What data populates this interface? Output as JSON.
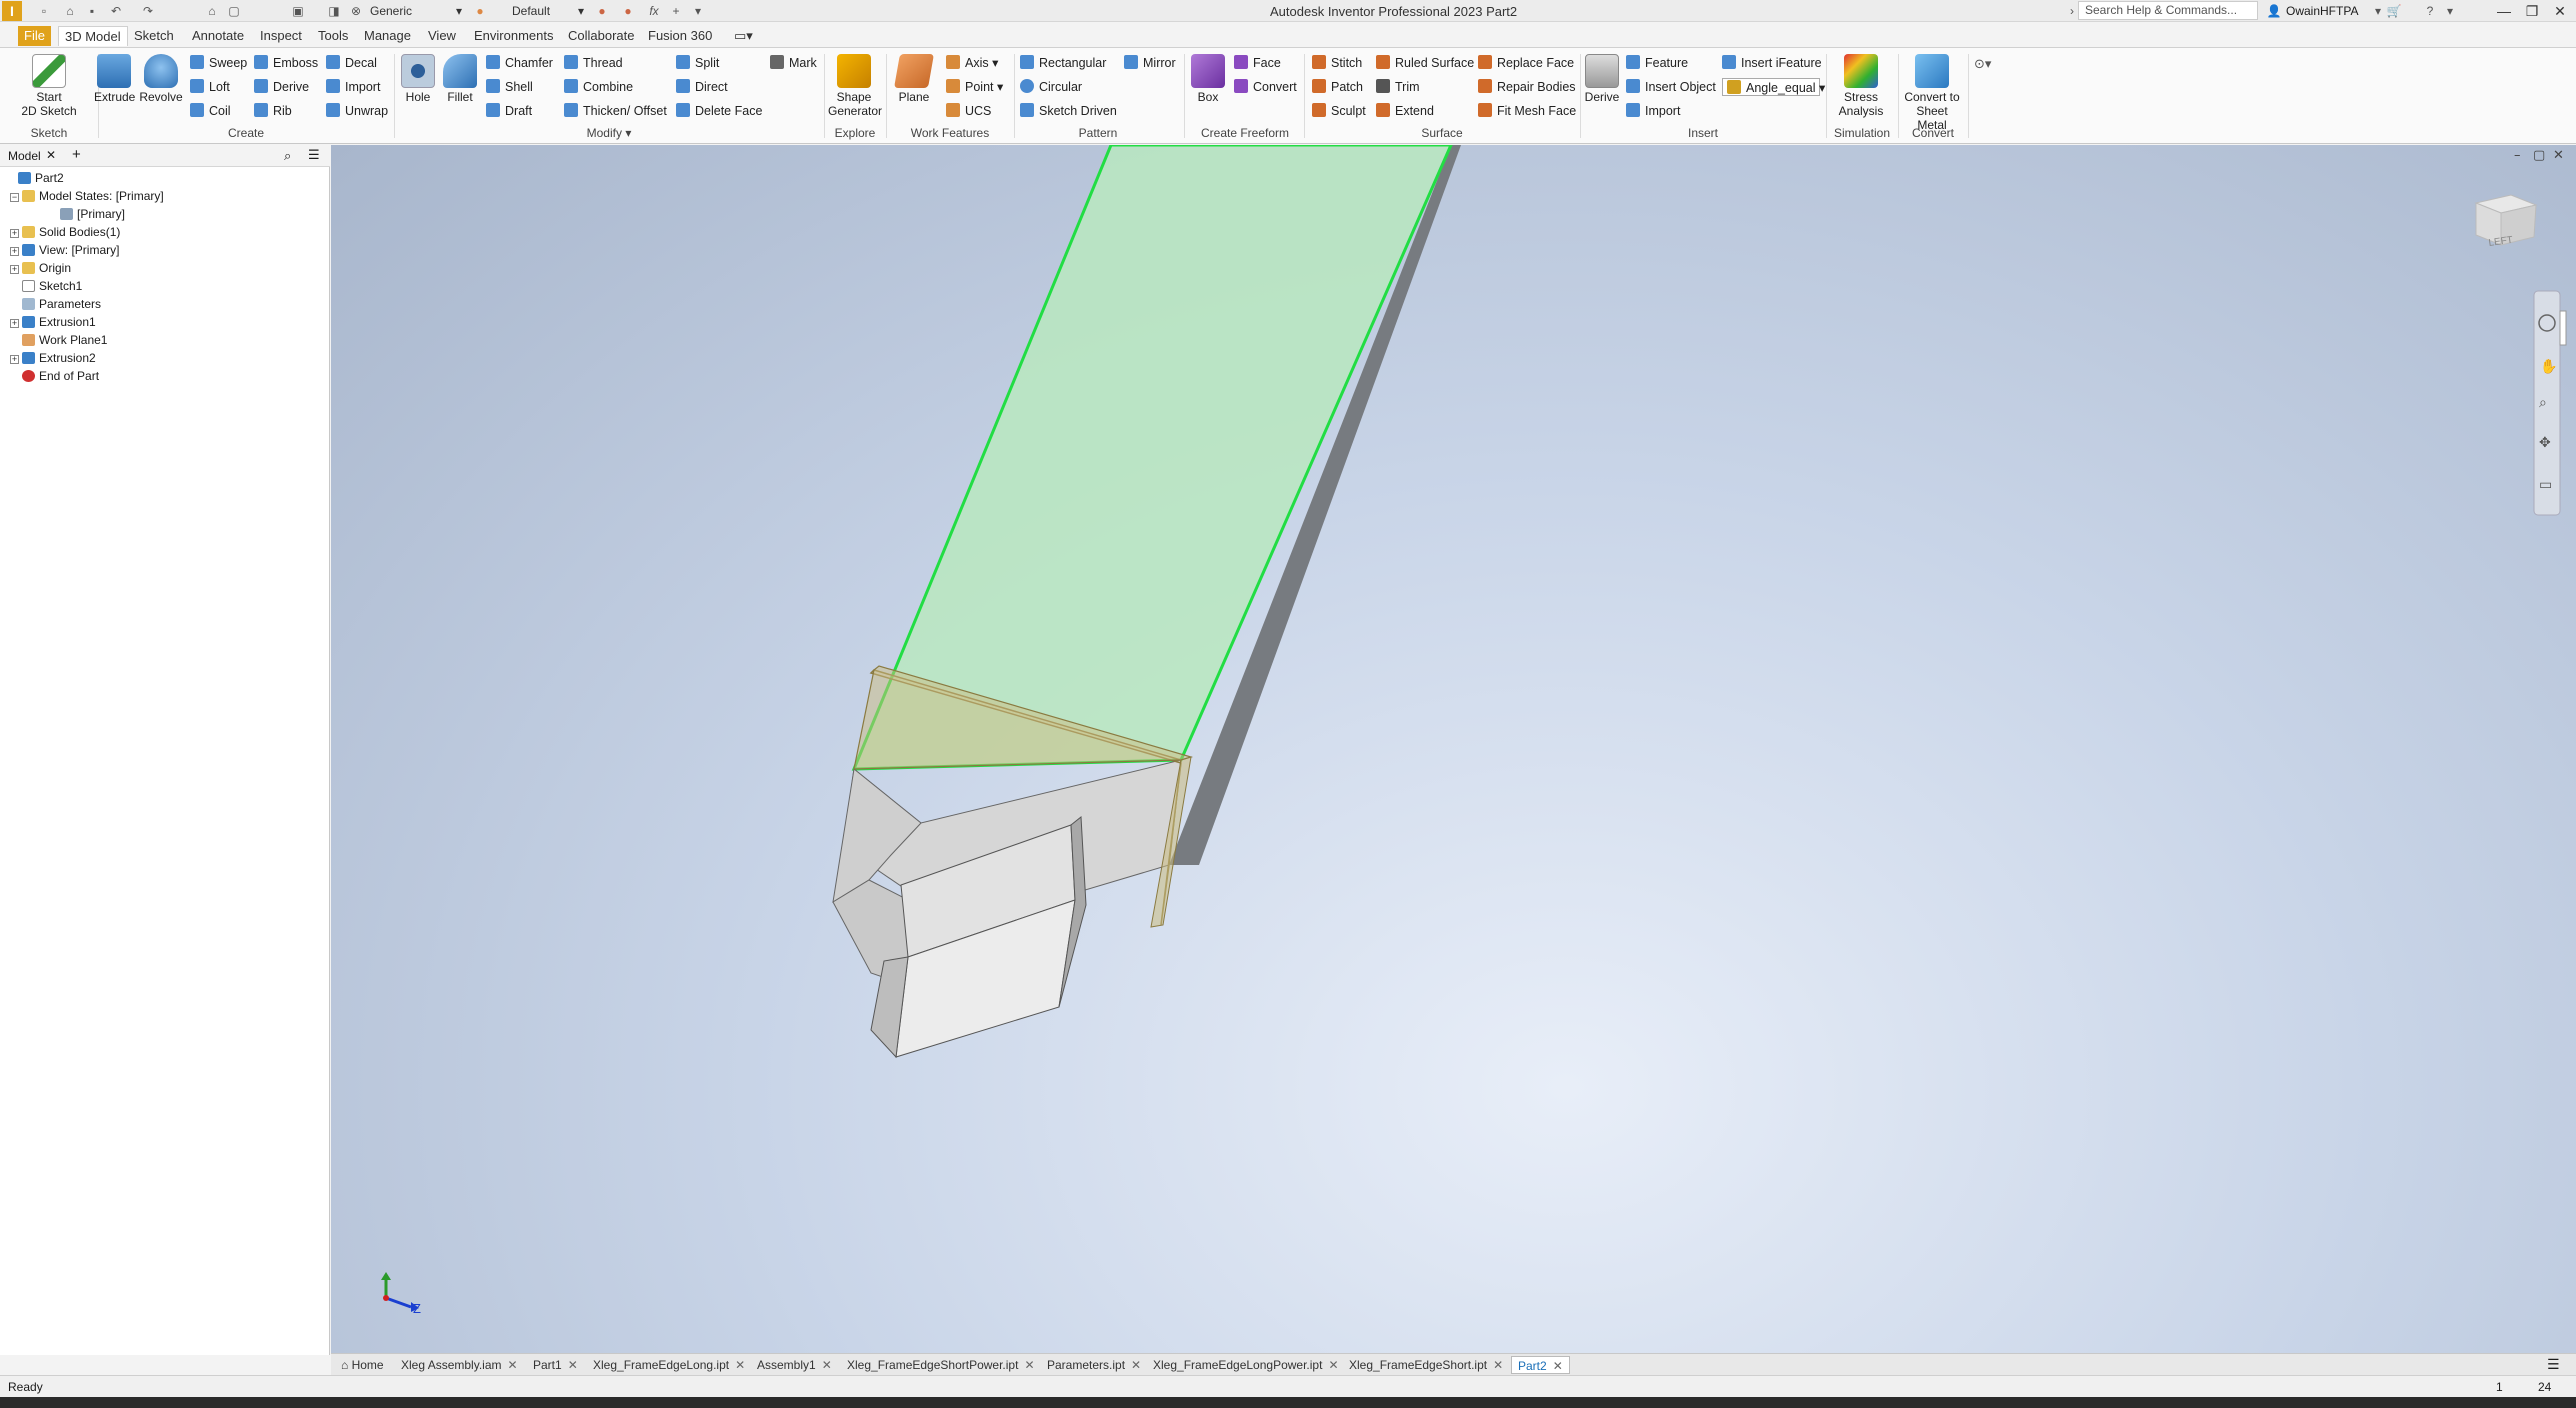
{
  "titlebar": {
    "app_letter": "I",
    "title": "Autodesk Inventor Professional 2023   Part2",
    "material": "Generic",
    "appearance": "Default",
    "fx_label": "fx",
    "search_placeholder": "Search Help & Commands...",
    "user": "OwainHFTPA"
  },
  "tabs": [
    "File",
    "3D Model",
    "Sketch",
    "Annotate",
    "Inspect",
    "Tools",
    "Manage",
    "View",
    "Environments",
    "Collaborate",
    "Fusion 360"
  ],
  "ribbon": {
    "sketch": {
      "label": "Sketch",
      "start_sketch": "Start\n2D Sketch"
    },
    "create": {
      "label": "Create",
      "extrude": "Extrude",
      "revolve": "Revolve",
      "col1": [
        "Sweep",
        "Loft",
        "Coil"
      ],
      "col2": [
        "Emboss",
        "Derive",
        "Rib"
      ],
      "col3": [
        "Decal",
        "Import",
        "Unwrap"
      ]
    },
    "modify": {
      "label": "Modify",
      "hole": "Hole",
      "fillet": "Fillet",
      "col1": [
        "Chamfer",
        "Shell",
        "Draft"
      ],
      "col2": [
        "Thread",
        "Combine",
        "Thicken/ Offset"
      ],
      "col3": [
        "Split",
        "Direct",
        "Delete Face"
      ],
      "mark": "Mark"
    },
    "explore": {
      "label": "Explore",
      "shape_generator": "Shape\nGenerator"
    },
    "work_features": {
      "label": "Work Features",
      "plane": "Plane",
      "axis": "Axis",
      "point": "Point",
      "ucs": "UCS"
    },
    "pattern": {
      "label": "Pattern",
      "rectangular": "Rectangular",
      "circular": "Circular",
      "sketch_driven": "Sketch Driven",
      "mirror": "Mirror"
    },
    "freeform": {
      "label": "Create Freeform",
      "box": "Box",
      "face": "Face",
      "convert": "Convert"
    },
    "surface": {
      "label": "Surface",
      "col1": [
        "Stitch",
        "Patch",
        "Sculpt"
      ],
      "col2": [
        "Ruled Surface",
        "Trim",
        "Extend"
      ],
      "col3": [
        "Replace Face",
        "Repair Bodies",
        "Fit Mesh Face"
      ]
    },
    "insert": {
      "label": "Insert",
      "derive": "Derive",
      "col1": [
        "Feature",
        "Insert Object",
        "Import"
      ],
      "ifeature": "Insert iFeature",
      "angle_equal": "Angle_equal"
    },
    "simulation": {
      "label": "Simulation",
      "stress": "Stress\nAnalysis"
    },
    "convert": {
      "label": "Convert",
      "sheet_metal": "Convert to\nSheet Metal"
    }
  },
  "browser": {
    "tab": "Model",
    "tree": [
      {
        "label": "Part2",
        "indent": 0,
        "exp": "",
        "icon": "part"
      },
      {
        "label": "Model States: [Primary]",
        "indent": 1,
        "exp": "−",
        "icon": "folder"
      },
      {
        "label": "[Primary]",
        "indent": 2,
        "exp": "",
        "icon": "state"
      },
      {
        "label": "Solid Bodies(1)",
        "indent": 1,
        "exp": "+",
        "icon": "folder"
      },
      {
        "label": "View: [Primary]",
        "indent": 1,
        "exp": "+",
        "icon": "view"
      },
      {
        "label": "Origin",
        "indent": 1,
        "exp": "+",
        "icon": "folder"
      },
      {
        "label": "Sketch1",
        "indent": 1,
        "exp": "",
        "icon": "sketch"
      },
      {
        "label": "Parameters",
        "indent": 1,
        "exp": "",
        "icon": "params"
      },
      {
        "label": "Extrusion1",
        "indent": 1,
        "exp": "+",
        "icon": "extrude"
      },
      {
        "label": "Work Plane1",
        "indent": 1,
        "exp": "",
        "icon": "plane"
      },
      {
        "label": "Extrusion2",
        "indent": 1,
        "exp": "+",
        "icon": "extrude"
      },
      {
        "label": "End of Part",
        "indent": 1,
        "exp": "",
        "icon": "end"
      }
    ]
  },
  "viewport": {
    "viewcube_face": "LEFT",
    "axis_z": "Z"
  },
  "doc_tabs": {
    "home": "Home",
    "items": [
      "Xleg Assembly.iam",
      "Part1",
      "Xleg_FrameEdgeLong.ipt",
      "Assembly1",
      "Xleg_FrameEdgeShortPower.ipt",
      "Parameters.ipt",
      "Xleg_FrameEdgeLongPower.ipt",
      "Xleg_FrameEdgeShort.ipt",
      "Part2"
    ],
    "active": "Part2"
  },
  "status": {
    "text": "Ready",
    "num1": "1",
    "num2": "24"
  },
  "colors": {
    "accent": "#e0a21b",
    "selection": "#22dd44",
    "face_fill": "#b9e7c0"
  }
}
